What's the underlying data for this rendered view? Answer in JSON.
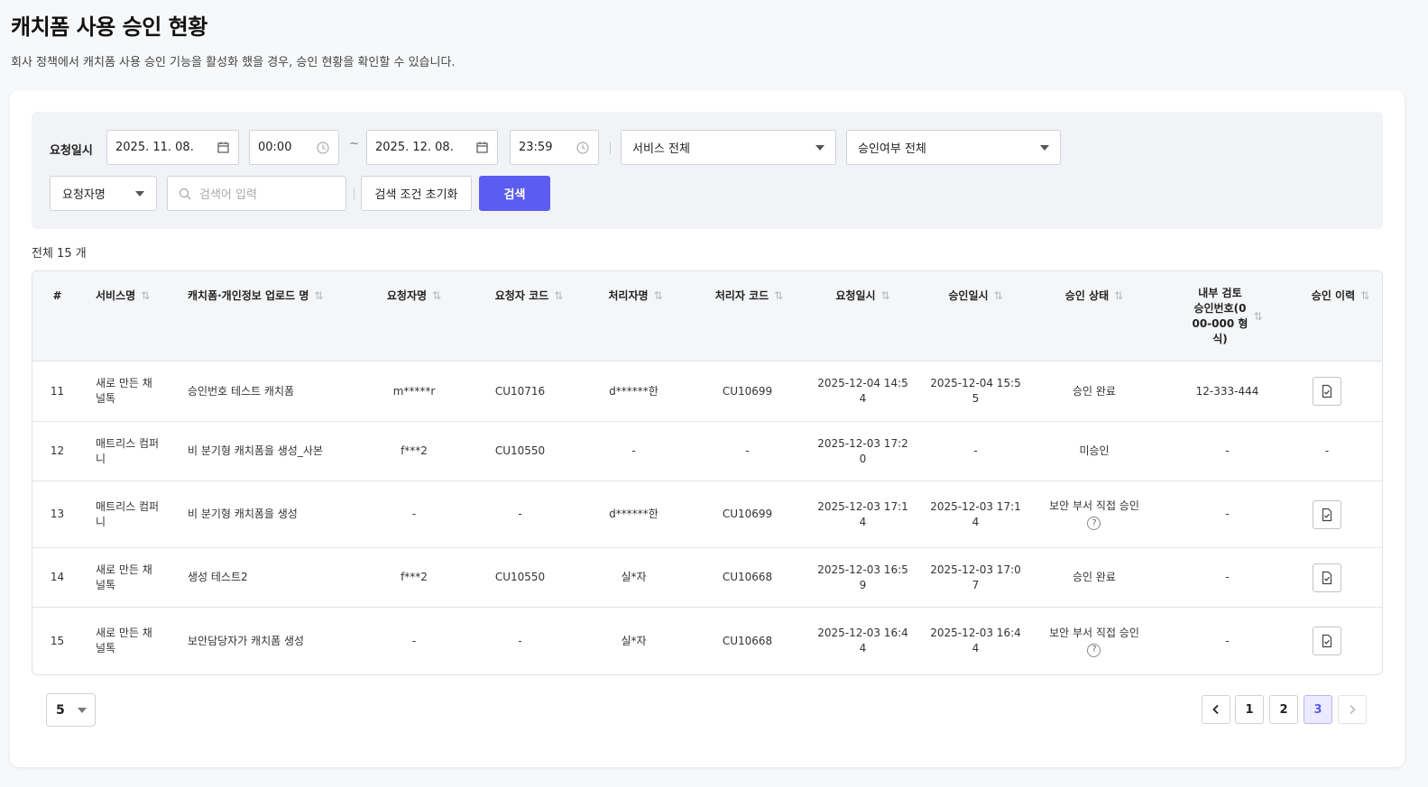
{
  "page": {
    "title": "캐치폼 사용 승인 현황",
    "description": "회사 정책에서 캐치폼 사용 승인 기능을 활성화 했을 경우, 승인 현황을 확인할 수 있습니다."
  },
  "filters": {
    "date_label": "요청일시",
    "start_date": "2025. 11. 08.",
    "start_time": "00:00",
    "range_sep": "~",
    "end_date": "2025. 12. 08.",
    "end_time": "23:59",
    "service_select": "서비스 전체",
    "approval_select": "승인여부 전체",
    "search_type": "요청자명",
    "search_placeholder": "검색어 입력",
    "reset_label": "검색 조건 초기화",
    "search_label": "검색"
  },
  "total_text": "전체 15 개",
  "table": {
    "headers": {
      "num": "#",
      "service": "서비스명",
      "form": "캐치폼·개인정보 업로드 명",
      "requester": "요청자명",
      "requester_code": "요청자 코드",
      "handler": "처리자명",
      "handler_code": "처리자 코드",
      "request_time": "요청일시",
      "approve_time": "승인일시",
      "status": "승인 상태",
      "internal_l1": "내부 검토",
      "internal_l2": "승인번호(0",
      "internal_l3": "00-000 형",
      "internal_l4": "식)",
      "history": "승인 이력"
    },
    "rows": [
      {
        "num": "11",
        "service_l1": "새로 만든 채",
        "service_l2": "널톡",
        "form": "승인번호 테스트 캐치폼",
        "requester": "m*****r",
        "requester_code": "CU10716",
        "handler": "d******한",
        "handler_code": "CU10699",
        "req_l1": "2025-12-04 14:5",
        "req_l2": "4",
        "apr_l1": "2025-12-04 15:5",
        "apr_l2": "5",
        "status": "승인 완료",
        "internal": "12-333-444",
        "history": "doc"
      },
      {
        "num": "12",
        "service_l1": "매트리스 컴퍼",
        "service_l2": "니",
        "form": "비 분기형 캐치폼을 생성_사본",
        "requester": "f***2",
        "requester_code": "CU10550",
        "handler": "-",
        "handler_code": "-",
        "req_l1": "2025-12-03 17:2",
        "req_l2": "0",
        "apr_l1": "-",
        "apr_l2": "",
        "status": "미승인",
        "internal": "-",
        "history": "-"
      },
      {
        "num": "13",
        "service_l1": "매트리스 컴퍼",
        "service_l2": "니",
        "form": "비 분기형 캐치폼을 생성",
        "requester": "-",
        "requester_code": "-",
        "handler": "d******한",
        "handler_code": "CU10699",
        "req_l1": "2025-12-03 17:1",
        "req_l2": "4",
        "apr_l1": "2025-12-03 17:1",
        "apr_l2": "4",
        "status": "보안 부서 직접 승인",
        "status_help": "?",
        "internal": "-",
        "history": "doc"
      },
      {
        "num": "14",
        "service_l1": "새로 만든 채",
        "service_l2": "널톡",
        "form": "생성 테스트2",
        "requester": "f***2",
        "requester_code": "CU10550",
        "handler": "실*자",
        "handler_code": "CU10668",
        "req_l1": "2025-12-03 16:5",
        "req_l2": "9",
        "apr_l1": "2025-12-03 17:0",
        "apr_l2": "7",
        "status": "승인 완료",
        "internal": "-",
        "history": "doc"
      },
      {
        "num": "15",
        "service_l1": "새로 만든 채",
        "service_l2": "널톡",
        "form": "보안담당자가 캐치폼 생성",
        "requester": "-",
        "requester_code": "-",
        "handler": "실*자",
        "handler_code": "CU10668",
        "req_l1": "2025-12-03 16:4",
        "req_l2": "4",
        "apr_l1": "2025-12-03 16:4",
        "apr_l2": "4",
        "status": "보안 부서 직접 승인",
        "status_help": "?",
        "internal": "-",
        "history": "doc"
      }
    ]
  },
  "pagination": {
    "page_size": "5",
    "pages": [
      "1",
      "2",
      "3"
    ],
    "current": "3"
  },
  "icons": {
    "calendar": "calendar-icon",
    "clock": "clock-icon",
    "search": "search-icon",
    "sort": "sort-icon",
    "doc": "document-check-icon",
    "help": "help-circle-icon"
  },
  "colors": {
    "primary": "#5b5cf0",
    "active_page_bg": "#eceaff"
  }
}
